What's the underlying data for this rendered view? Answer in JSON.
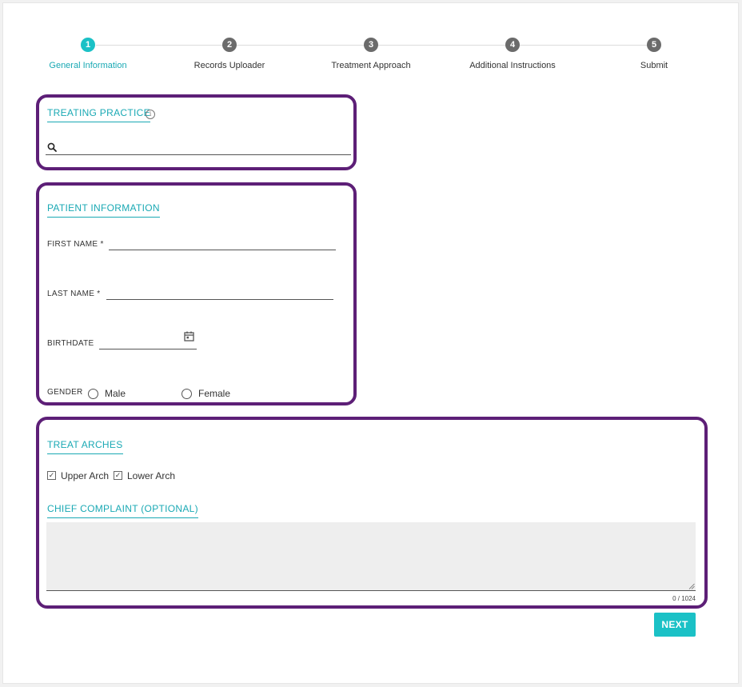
{
  "stepper": {
    "steps": [
      {
        "number": "1",
        "label": "General Information",
        "active": true
      },
      {
        "number": "2",
        "label": "Records Uploader",
        "active": false
      },
      {
        "number": "3",
        "label": "Treatment Approach",
        "active": false
      },
      {
        "number": "4",
        "label": "Additional Instructions",
        "active": false
      },
      {
        "number": "5",
        "label": "Submit",
        "active": false
      }
    ]
  },
  "treating_practice": {
    "title": "TREATING PRACTICE",
    "info_icon": "info-icon",
    "search_icon": "search-icon",
    "search_value": "",
    "search_placeholder": ""
  },
  "patient_information": {
    "title": "PATIENT INFORMATION",
    "first_name_label": "FIRST NAME *",
    "first_name_value": "",
    "last_name_label": "LAST NAME *",
    "last_name_value": "",
    "birthdate_label": "BIRTHDATE",
    "birthdate_value": "",
    "calendar_icon": "calendar-icon",
    "gender_label": "GENDER",
    "gender_options": [
      "Male",
      "Female"
    ]
  },
  "treat_arches": {
    "title": "TREAT ARCHES",
    "upper_arch_label": "Upper Arch",
    "upper_arch_checked": true,
    "lower_arch_label": "Lower Arch",
    "lower_arch_checked": true,
    "chief_complaint_title": "CHIEF COMPLAINT (OPTIONAL)",
    "chief_complaint_value": "",
    "char_counter": "0 / 1024"
  },
  "actions": {
    "next_label": "NEXT"
  },
  "colors": {
    "accent": "#1bc1c6",
    "accent_text": "#1aa9b4",
    "section_border": "#5d1f77",
    "inactive_step": "#6b6b6b"
  }
}
